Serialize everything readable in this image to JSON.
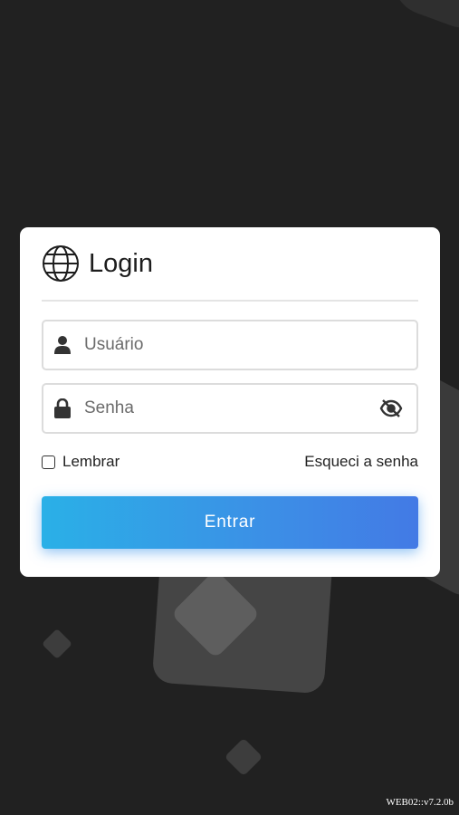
{
  "login": {
    "title": "Login",
    "username": {
      "value": "",
      "placeholder": "Usuário"
    },
    "password": {
      "value": "",
      "placeholder": "Senha"
    },
    "remember_label": "Lembrar",
    "remember_checked": false,
    "forgot_label": "Esqueci a senha",
    "submit_label": "Entrar"
  },
  "icons": {
    "logo": "globe-icon",
    "username": "user-icon",
    "password": "lock-icon",
    "toggle_password": "eye-slash-icon"
  },
  "footer": {
    "version": "WEB02::v7.2.0b"
  },
  "colors": {
    "background": "#212121",
    "card": "#ffffff",
    "button_start": "#2ab0e7",
    "button_end": "#437ae5",
    "button_text": "#ffffff"
  }
}
